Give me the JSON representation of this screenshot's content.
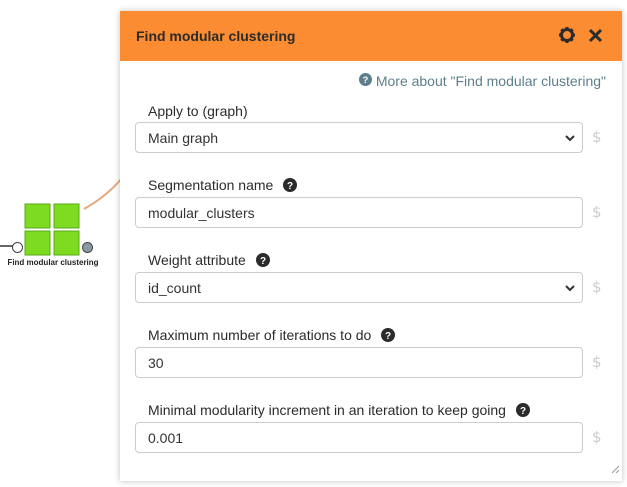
{
  "node": {
    "label": "Find modular clustering"
  },
  "popup": {
    "title": "Find modular clustering",
    "help_link": "More about \"Find modular clustering\"",
    "fields": [
      {
        "label": "Apply to (graph)",
        "value": "Main graph",
        "type": "select",
        "has_help": false
      },
      {
        "label": "Segmentation name",
        "value": "modular_clusters",
        "type": "text",
        "has_help": true
      },
      {
        "label": "Weight attribute",
        "value": "id_count",
        "type": "select",
        "has_help": true
      },
      {
        "label": "Maximum number of iterations to do",
        "value": "30",
        "type": "text",
        "has_help": true
      },
      {
        "label": "Minimal modularity increment in an iteration to keep going",
        "value": "0.001",
        "type": "text",
        "has_help": true
      }
    ],
    "param_symbol": "$"
  },
  "colors": {
    "header": "#fb8c32",
    "node_green": "#7ddc1f",
    "help_link": "#5d7f8c"
  },
  "icons": [
    "gear-icon",
    "close-icon",
    "question-circle-icon",
    "chevron-down-icon",
    "resize-handle-icon"
  ]
}
